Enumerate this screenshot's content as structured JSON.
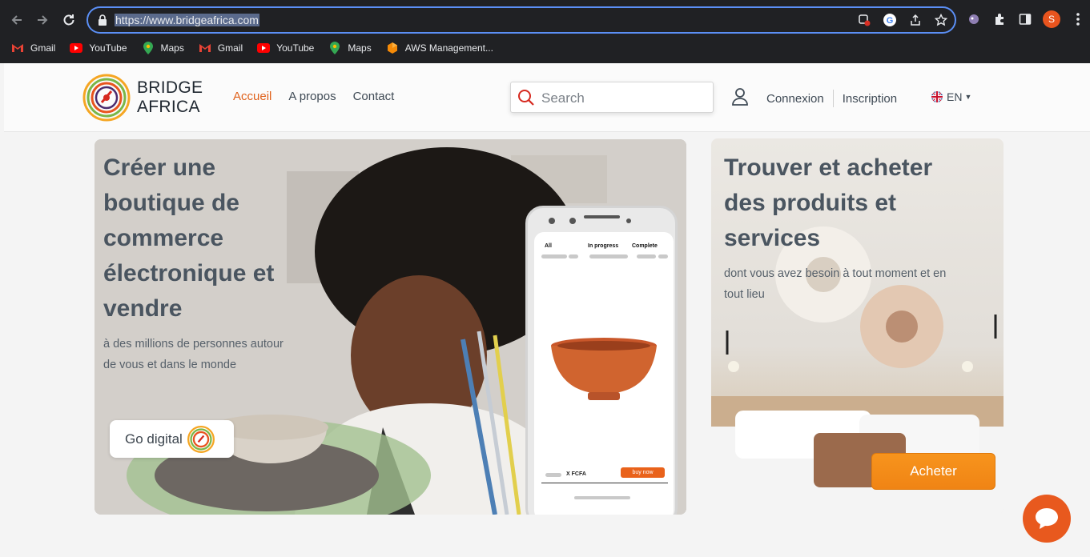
{
  "browser": {
    "url": "https://www.bridgeafrica.com",
    "bookmarks": [
      {
        "label": "Gmail",
        "icon": "gmail-icon"
      },
      {
        "label": "YouTube",
        "icon": "youtube-icon"
      },
      {
        "label": "Maps",
        "icon": "maps-icon"
      },
      {
        "label": "Gmail",
        "icon": "gmail-icon"
      },
      {
        "label": "YouTube",
        "icon": "youtube-icon"
      },
      {
        "label": "Maps",
        "icon": "maps-icon"
      },
      {
        "label": "AWS Management...",
        "icon": "aws-icon"
      }
    ],
    "profile_initial": "S",
    "colors": {
      "frame": "#202124",
      "omnibox_border": "#5b8ff5",
      "profile": "#e8541e"
    }
  },
  "header": {
    "logo_line1": "BRIDGE",
    "logo_line2": "AFRICA",
    "nav": [
      {
        "label": "Accueil",
        "active": true
      },
      {
        "label": "A propos",
        "active": false
      },
      {
        "label": "Contact",
        "active": false
      }
    ],
    "search_placeholder": "Search",
    "login": "Connexion",
    "signup": "Inscription",
    "language": "EN",
    "accent": "#e0621c"
  },
  "hero_left": {
    "title": [
      "Créer une",
      "boutique de",
      "commerce",
      "électronique et",
      "vendre"
    ],
    "subtitle": [
      "à des millions de personnes autour",
      "de vous et dans le monde"
    ],
    "cta": "Go digital",
    "phone": {
      "tabs": [
        "All",
        "In progress",
        "Complete"
      ],
      "price": "X FCFA",
      "buy": "buy now"
    }
  },
  "hero_right": {
    "title": [
      "Trouver et acheter",
      "des produits et",
      "services"
    ],
    "subtitle": [
      "dont vous avez besoin à tout moment et en",
      "tout lieu"
    ],
    "cta": "Acheter",
    "cta_color": "#f7941d"
  }
}
